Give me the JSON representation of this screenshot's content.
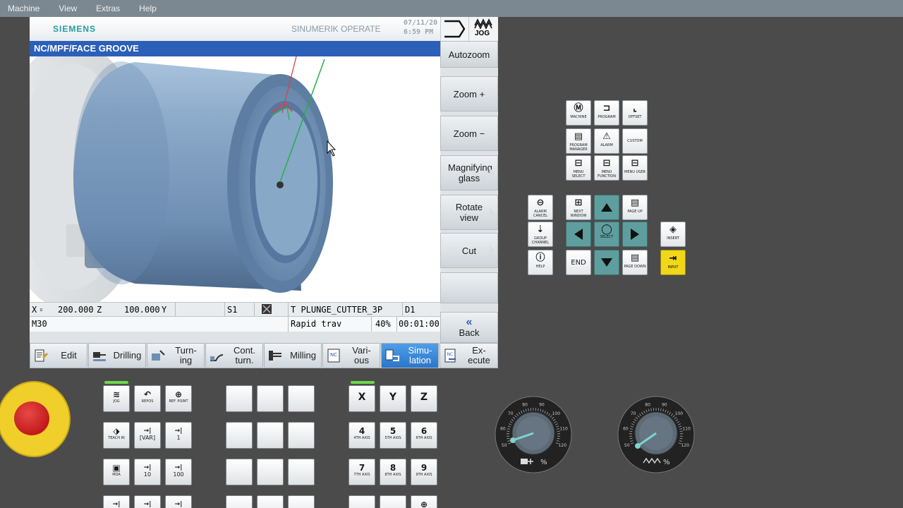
{
  "menubar": {
    "items": [
      "Machine",
      "View",
      "Extras",
      "Help"
    ]
  },
  "header": {
    "brand": "SIEMENS",
    "product": "SINUMERIK OPERATE",
    "date": "07/11/20",
    "time": "6:59 PM",
    "mode": "JOG"
  },
  "path": "NC/MPF/FACE GROOVE",
  "status": {
    "x_label": "X",
    "x_value": "200.000",
    "z_label": "Z",
    "z_value": "100.000",
    "y_label": "Y",
    "spindle": "S1",
    "tool": "T PLUNGE_CUTTER_3P",
    "d": "D1",
    "block": "M30",
    "feed_mode": "Rapid trav",
    "override": "40%",
    "elapsed": "00:01:00"
  },
  "vertical_softkeys": [
    {
      "label": "Autozoom"
    },
    {
      "label": "Zoom +"
    },
    {
      "label": "Zoom −"
    },
    {
      "label": "Magnifying glass"
    },
    {
      "label": "Rotate view"
    },
    {
      "label": "Cut"
    },
    {
      "label": ""
    },
    {
      "label": "Back"
    }
  ],
  "horizontal_softkeys": [
    {
      "label": "Edit"
    },
    {
      "label": "Drilling"
    },
    {
      "label": "Turn- ing"
    },
    {
      "label": "Cont. turn."
    },
    {
      "label": "Milling"
    },
    {
      "label": "Vari- ous"
    },
    {
      "label": "Simu- lation"
    },
    {
      "label": "Ex- ecute"
    }
  ],
  "keypad": {
    "machine": "MACHINE",
    "program": "PROGRAM",
    "offset": "OFFSET",
    "program_manager": "PROGRAM MANAGER",
    "alarm": "ALARM",
    "custom": "CUSTOM",
    "menu_select": "MENU SELECT",
    "menu_function": "MENU FUNCTION",
    "menu_user": "MENU USER",
    "alarm_cancel": "ALARM CANCEL",
    "next_window": "NEXT WINDOW",
    "page_up": "PAGE UP",
    "group_channel": "GROUP CHANNEL",
    "select": "SELECT",
    "insert": "INSERT",
    "help": "HELP",
    "end": "END",
    "page_down": "PAGE DOWN",
    "input": "INPUT"
  },
  "machine_keys": {
    "jog": "JOG",
    "repos": "REPOS",
    "ref_point": "REF. POINT",
    "teach_in": "TEACH IN",
    "var": "[VAR]",
    "inc1": "1",
    "mda": "MDA",
    "inc10": "10",
    "inc100": "100"
  },
  "axis_keys": {
    "x": "X",
    "y": "Y",
    "z": "Z",
    "a4": "4",
    "a4_txt": "4TH AXIS",
    "a5": "5",
    "a5_txt": "5TH AXIS",
    "a6": "6",
    "a6_txt": "6TH AXIS",
    "a7": "7",
    "a7_txt": "7TH AXIS",
    "a8": "8",
    "a8_txt": "8TH AXIS",
    "a9": "9",
    "a9_txt": "9TH AXIS"
  },
  "dials": {
    "feed": {
      "ticks": [
        "50",
        "60",
        "70",
        "80",
        "90",
        "100",
        "110",
        "120"
      ],
      "unit": "%"
    },
    "spindle": {
      "ticks": [
        "50",
        "60",
        "70",
        "80",
        "90",
        "100",
        "110",
        "120"
      ],
      "unit": "%"
    }
  },
  "colors": {
    "accent": "#2b5fb8",
    "active_softkey": "#3a88d6",
    "cursor_key": "#5f9e9e",
    "input_key": "#f0d818"
  }
}
